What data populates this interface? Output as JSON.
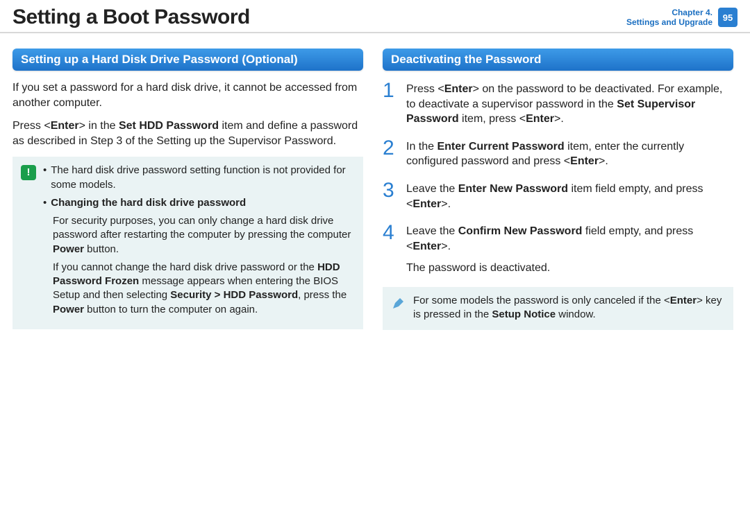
{
  "header": {
    "title": "Setting a Boot Password",
    "chapter_line1": "Chapter 4.",
    "chapter_line2": "Settings and Upgrade",
    "page_number": "95"
  },
  "left": {
    "section_title": "Setting up a Hard Disk Drive Password (Optional)",
    "para1": "If you set a password for a hard disk drive, it cannot be accessed from another computer.",
    "para2_a": "Press <",
    "para2_enter": "Enter",
    "para2_b": "> in the ",
    "para2_bold": "Set HDD Password",
    "para2_c": " item and define a password as described in Step 3 of the Setting up the Supervisor Password.",
    "note": {
      "bullet1": "The hard disk drive password setting function is not provided for some models.",
      "bullet2_bold": "Changing the hard disk drive password",
      "bullet2_p1_a": "For security purposes, you can only change a hard disk drive password after restarting the computer by pressing the computer ",
      "bullet2_p1_bold": "Power",
      "bullet2_p1_b": " button.",
      "bullet2_p2_a": "If you cannot change the hard disk drive password or the ",
      "bullet2_p2_bold1": "HDD Password Frozen",
      "bullet2_p2_b": " message appears when entering the BIOS Setup and then selecting ",
      "bullet2_p2_bold2": "Security > HDD Password",
      "bullet2_p2_c": ", press the ",
      "bullet2_p2_bold3": "Power",
      "bullet2_p2_d": " button to turn the computer on again."
    }
  },
  "right": {
    "section_title": "Deactivating the Password",
    "steps": {
      "s1_a": "Press <",
      "s1_b": "Enter",
      "s1_c": "> on the password to be deactivated. For example, to deactivate a supervisor password in the ",
      "s1_bold": "Set Supervisor Password",
      "s1_d": " item, press <",
      "s1_e": "Enter",
      "s1_f": ">.",
      "s2_a": "In the ",
      "s2_bold": "Enter Current Password",
      "s2_b": " item, enter the currently configured password and press <",
      "s2_c": "Enter",
      "s2_d": ">.",
      "s3_a": "Leave the ",
      "s3_bold": "Enter New Password",
      "s3_b": " item field empty, and press <",
      "s3_c": "Enter",
      "s3_d": ">.",
      "s4_a": "Leave the ",
      "s4_bold": "Confirm New Password",
      "s4_b": " field empty, and press <",
      "s4_c": "Enter",
      "s4_d": ">.",
      "s4_tail": "The password is deactivated."
    },
    "note_a": "For some models the password is only canceled if the <",
    "note_b": "Enter",
    "note_c": "> key is pressed in the ",
    "note_bold": "Setup Notice",
    "note_d": " window."
  },
  "numbers": {
    "n1": "1",
    "n2": "2",
    "n3": "3",
    "n4": "4"
  },
  "icons": {
    "alert": "!",
    "bullet": "•"
  }
}
